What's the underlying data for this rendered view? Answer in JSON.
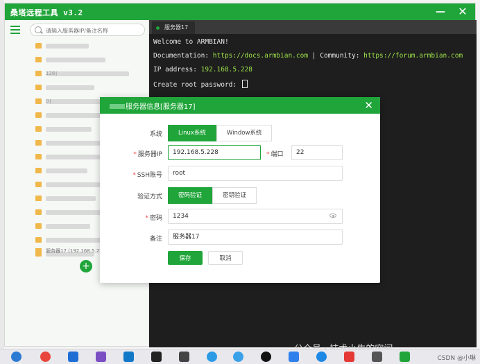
{
  "app": {
    "title": "桑塔远程工具 v3.2",
    "minimize": "—",
    "close": "✕"
  },
  "left_pane": {
    "search_placeholder": "请输入服务器IP/备注名称",
    "items": [
      "",
      "",
      "128]",
      "",
      "0]",
      "",
      "",
      "",
      "",
      "",
      "",
      "",
      "",
      "",
      "",
      ""
    ],
    "selected_item": "服务器17 (192.168.5.228)",
    "add_label": "+"
  },
  "terminal": {
    "tab_label": "服务器17",
    "line1": "Welcome to ARMBIAN!",
    "doc_label": "Documentation: ",
    "doc_url": "https://docs.armbian.com",
    "sep": " | Community: ",
    "community_url": "https://forum.armbian.com",
    "ip_label": "IP address: ",
    "ip_value": "192.168.5.228",
    "prompt": "Create root password: "
  },
  "dialog": {
    "title": "服务器信息[服务器17]",
    "close": "✕",
    "system_label": "系统",
    "system_options": [
      "Linux系统",
      "Window系统"
    ],
    "ip_label": "服务器IP",
    "ip_value": "192.168.5.228",
    "port_label": "端口",
    "port_value": "22",
    "ssh_label": "SSH账号",
    "ssh_value": "root",
    "auth_label": "验证方式",
    "auth_options": [
      "密码验证",
      "密钥验证"
    ],
    "password_label": "密码",
    "password_value": "1234",
    "remark_label": "备注",
    "remark_value": "服务器17",
    "save_label": "保存",
    "cancel_label": "取消",
    "required_mark": "*"
  },
  "watermark": "公众号 · 技术小牛的空间",
  "taskbar": {
    "csdn": "CSDN @小琳"
  },
  "colors": {
    "accent": "#20a53a",
    "terminal_bg": "#1e1e1e",
    "link": "#9ee34a"
  }
}
